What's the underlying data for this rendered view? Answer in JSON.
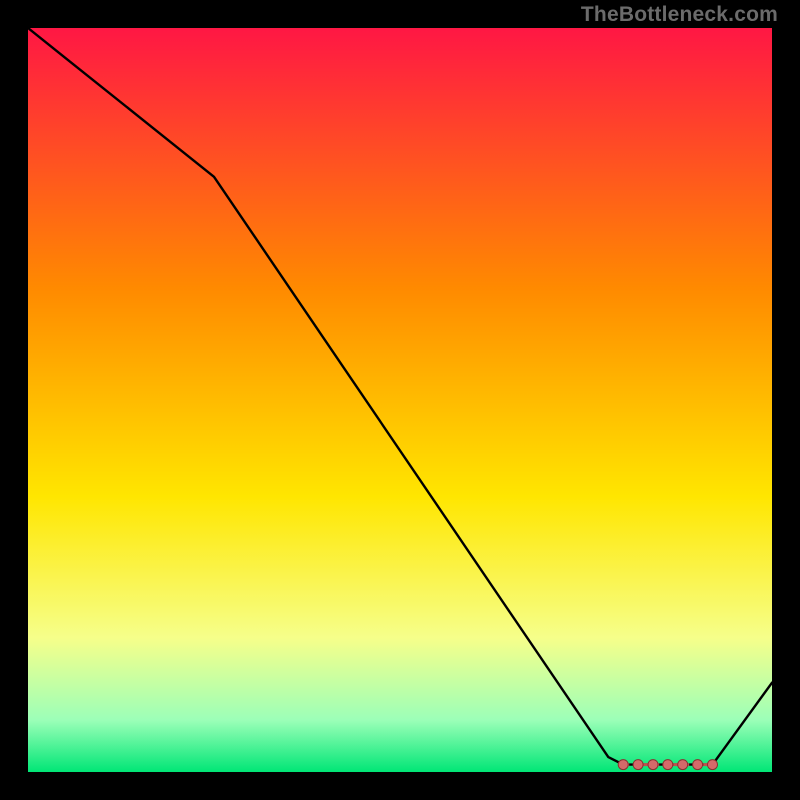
{
  "attribution": "TheBottleneck.com",
  "gradient": {
    "top": "#ff1744",
    "upper_mid": "#ff8a00",
    "mid": "#ffe600",
    "lower_mid": "#f6ff8a",
    "green_pale": "#9cffb8",
    "bottom": "#00e676"
  },
  "chart_data": {
    "type": "line",
    "title": "",
    "xlabel": "",
    "ylabel": "",
    "xlim": [
      0,
      100
    ],
    "ylim": [
      0,
      100
    ],
    "series": [
      {
        "name": "curve",
        "x": [
          0,
          5,
          25,
          78,
          80,
          90,
          92,
          100
        ],
        "values": [
          100,
          96,
          80,
          2,
          1,
          1,
          1,
          12
        ]
      }
    ],
    "markers": {
      "name": "optimum-band",
      "x": [
        80,
        82,
        84,
        86,
        88,
        90,
        92
      ],
      "values": [
        1,
        1,
        1,
        1,
        1,
        1,
        1
      ]
    },
    "annotations": []
  }
}
